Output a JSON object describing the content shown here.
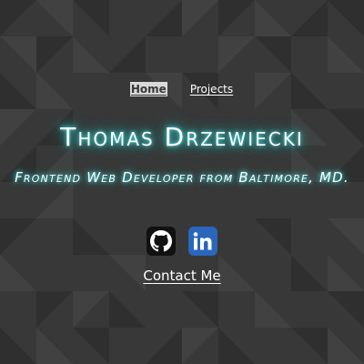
{
  "nav": {
    "items": [
      {
        "label": "Home",
        "active": true
      },
      {
        "label": "Projects",
        "active": false
      }
    ]
  },
  "hero": {
    "name": "Thomas Drzewiecki",
    "tagline": "Frontend Web Developer from Baltimore, MD."
  },
  "socials": [
    {
      "icon": "github-icon"
    },
    {
      "icon": "linkedin-icon"
    }
  ],
  "contact": {
    "label": "Contact Me"
  },
  "colors": {
    "background": "#383838",
    "glow": "#2ac7c7",
    "linkedin": "#2a66bc"
  }
}
